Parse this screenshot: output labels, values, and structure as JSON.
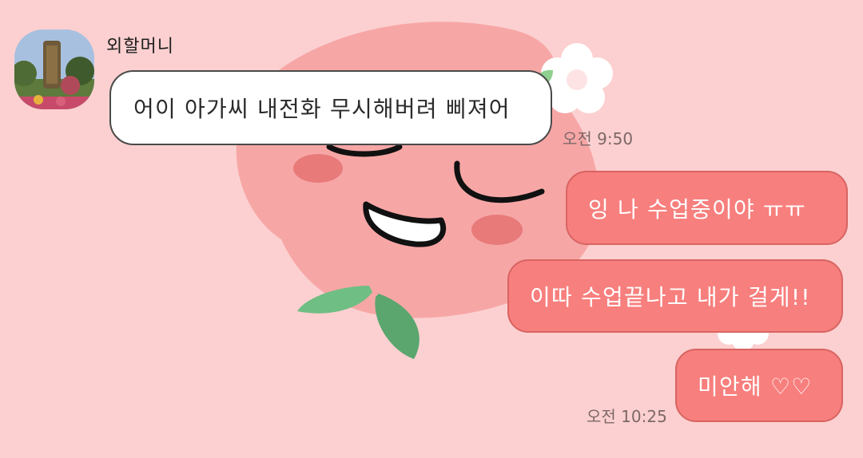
{
  "colors": {
    "background": "#fcd0d0",
    "outgoing_bubble": "#f77f7d",
    "incoming_bubble": "#ffffff",
    "character_body": "#f7a6a6"
  },
  "background_icons": [
    "peach-character",
    "flower-icon",
    "leaf-icon"
  ],
  "contact": {
    "name": "외할머니",
    "avatar_icon": "avatar-photo"
  },
  "messages": [
    {
      "direction": "incoming",
      "text": "어이 아가씨 내전화 무시해버려 삐져어",
      "time": "오전 9:50"
    },
    {
      "direction": "outgoing",
      "text": "잉 나 수업중이야 ㅠㅠ"
    },
    {
      "direction": "outgoing",
      "text": "이따 수업끝나고 내가 걸게!!"
    },
    {
      "direction": "outgoing",
      "text": "미안해 ♡♡",
      "time": "오전 10:25"
    }
  ]
}
